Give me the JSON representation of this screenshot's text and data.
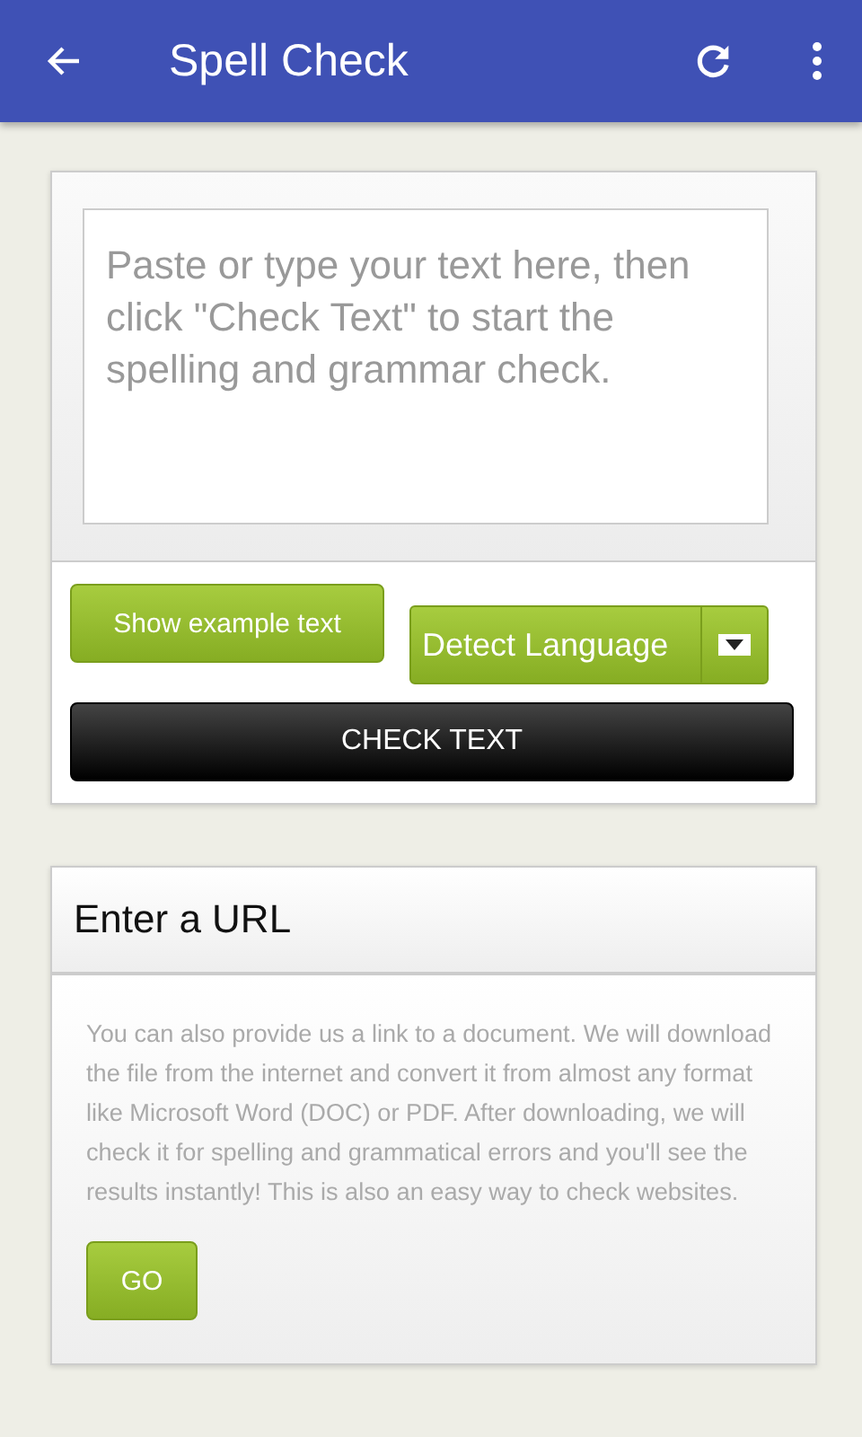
{
  "app_bar": {
    "title": "Spell Check"
  },
  "editor": {
    "placeholder": "Paste or type your text here, then click \"Check Text\" to start the spelling and grammar check.",
    "example_button": "Show example text",
    "language": "Detect Language",
    "check_button": "CHECK TEXT"
  },
  "url_section": {
    "title": "Enter a URL",
    "description": "You can also provide us a link to a document. We will download the file from the internet and convert it from almost any format like Microsoft Word (DOC) or PDF. After downloading, we will check it for spelling and grammatical errors and you'll see the results instantly! This is also an easy way to check websites.",
    "go_button": "GO"
  }
}
